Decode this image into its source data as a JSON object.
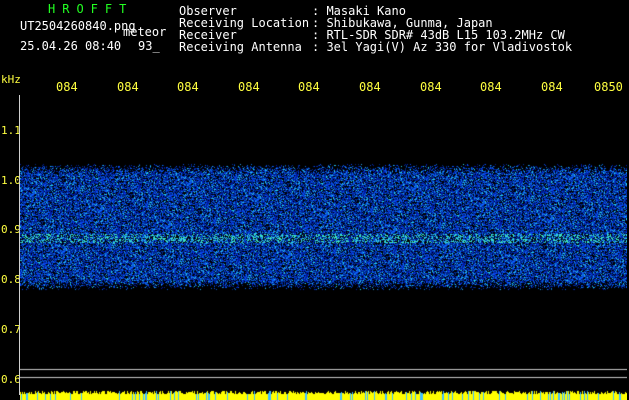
{
  "logo": "HROFFT",
  "filename": "UT2504260840.png",
  "meteor_label": "meteor",
  "datetime": "25.04.26 08:40",
  "meteor_count": "93_",
  "info": [
    {
      "label": "Observer",
      "value": ": Masaki Kano"
    },
    {
      "label": "Receiving Location",
      "value": ": Shibukawa, Gunma, Japan"
    },
    {
      "label": "Receiver",
      "value": ": RTL-SDR SDR# 43dB L15 103.2MHz CW"
    },
    {
      "label": "Receiving Antenna",
      "value": ": 3el Yagi(V) Az 330 for Vladivostok"
    }
  ],
  "y_unit": "kHz",
  "y_ticks": [
    "1.1",
    "1.0",
    "0.9",
    "0.8",
    "0.7",
    "0.6"
  ],
  "x_ticks": [
    "084",
    "084",
    "084",
    "084",
    "084",
    "084",
    "084",
    "084",
    "084",
    "0850"
  ],
  "colors": {
    "background": "#000000",
    "text": "#ffffff",
    "accent": "#ffff40",
    "logo": "#22ff22",
    "noise": "#1a3cff",
    "signal": "#40ffd0"
  }
}
